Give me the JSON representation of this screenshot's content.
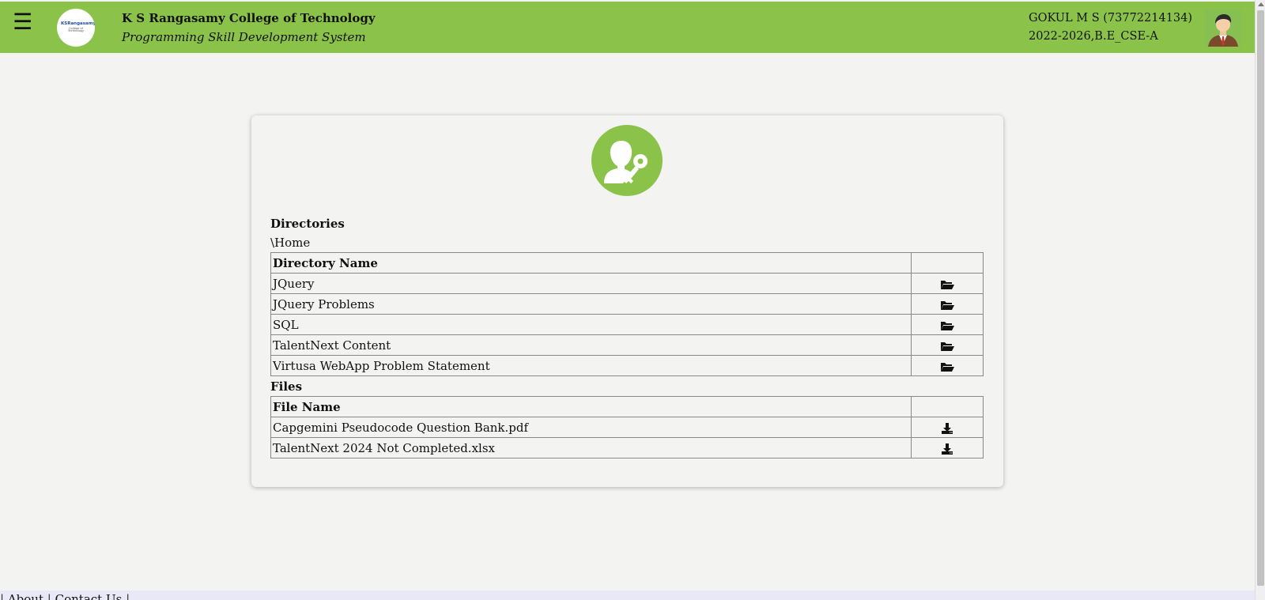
{
  "header": {
    "menu_icon": "hamburger-icon",
    "logo_text": "KSRangasamy",
    "logo_subtext": "College of Technology",
    "college_name": "K S Rangasamy College of Technology",
    "system_name": "Programming Skill Development System",
    "user_name": "GOKUL M S (73772214134)",
    "user_batch": "2022-2026,B.E_CSE-A",
    "brand_color": "#8bc34a"
  },
  "card": {
    "badge_icon": "user-key-icon",
    "directories_label": "Directories",
    "path": "\\Home",
    "directories_table": {
      "header": "Directory Name",
      "action_icon": "folder-open-icon",
      "rows": [
        "JQuery",
        "JQuery Problems",
        "SQL",
        "TalentNext Content",
        "Virtusa WebApp Problem Statement"
      ]
    },
    "files_label": "Files",
    "files_table": {
      "header": "File Name",
      "action_icon": "download-icon",
      "rows": [
        "Capgemini Pseudocode Question Bank.pdf",
        "TalentNext 2024 Not Completed.xlsx"
      ]
    }
  },
  "footer": {
    "separator": "|",
    "about": "About",
    "contact": "Contact Us"
  }
}
